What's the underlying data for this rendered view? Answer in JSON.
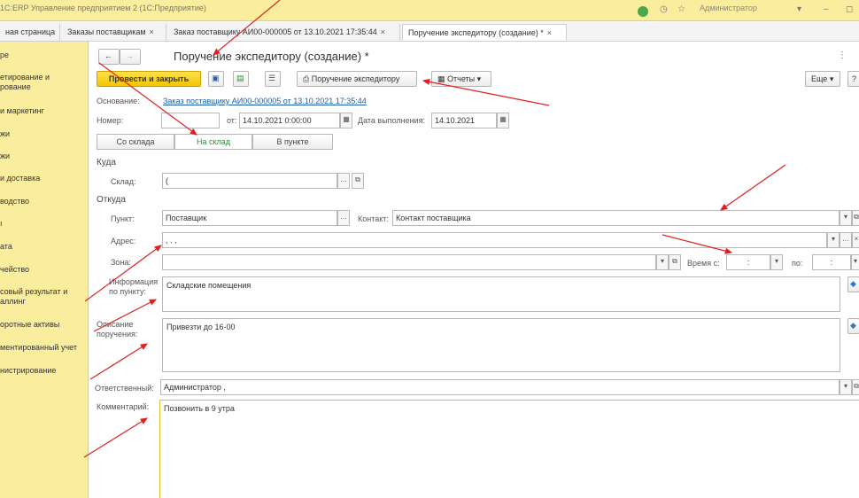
{
  "topbar": {
    "app_title": "1С:ERP Управление предприятием 2  (1С:Предприятие)",
    "user": "Администратор"
  },
  "tabs": [
    {
      "label": "ная страница"
    },
    {
      "label": "Заказы поставщикам"
    },
    {
      "label": "Заказ поставщику АИ00-000005 от 13.10.2021 17:35:44"
    },
    {
      "label": "Поручение экспедитору (создание) *"
    }
  ],
  "sidebar": {
    "items": [
      {
        "label": "ре"
      },
      {
        "label": "етирование и\nрование"
      },
      {
        "label": "и маркетинг"
      },
      {
        "label": "жи"
      },
      {
        "label": "жи"
      },
      {
        "label": "и доставка"
      },
      {
        "label": "водство"
      },
      {
        "label": "ı"
      },
      {
        "label": "ата"
      },
      {
        "label": "чейство"
      },
      {
        "label": "совый результат и\nаллинг"
      },
      {
        "label": "оротные активы"
      },
      {
        "label": "ментированный учет"
      },
      {
        "label": "\nнистрирование"
      }
    ]
  },
  "form": {
    "title": "Поручение экспедитору (создание) *",
    "toolbar": {
      "post_close": "Провести и закрыть",
      "print_order": "Поручение экспедитору",
      "reports": "Отчеты",
      "more": "Еще",
      "help": "?"
    },
    "basis": {
      "label": "Основание:",
      "link": "Заказ поставщику АИ00-000005 от 13.10.2021 17:35:44"
    },
    "number": {
      "label": "Номер:",
      "value": ""
    },
    "date_from": {
      "label": "от:",
      "value": "14.10.2021  0:00:00"
    },
    "exec_date": {
      "label": "Дата выполнения:",
      "value": "14.10.2021"
    },
    "segments": [
      "Со склада",
      "На склад",
      "В пункте"
    ],
    "to_section": "Куда",
    "warehouse": {
      "label": "Склад:",
      "value": "("
    },
    "from_section": "Откуда",
    "point": {
      "label": "Пункт:",
      "value": "Поставщик"
    },
    "contact": {
      "label": "Контакт:",
      "value": "Контакт поставщика"
    },
    "address": {
      "label": "Адрес:",
      "value": ", .      ,"
    },
    "zone": {
      "label": "Зона:",
      "value": ""
    },
    "time_from": {
      "label": "Время с:",
      "value": ":"
    },
    "time_to": {
      "label": "по:",
      "value": ":"
    },
    "point_info": {
      "label": "Информация\nпо пункту:",
      "value": "Складские помещения"
    },
    "description": {
      "label": "Описание\nпоручения:",
      "value": "Привезти до 16-00"
    },
    "responsible": {
      "label": "Ответственный:",
      "value": "Администратор   ,"
    },
    "comment": {
      "label": "Комментарий:",
      "value": "Позвонить в 9 утра"
    }
  },
  "colors": {
    "accent": "#f4c400",
    "sidebar": "#fbed9e",
    "link": "#1a5fa8",
    "annotation": "#e02020"
  }
}
